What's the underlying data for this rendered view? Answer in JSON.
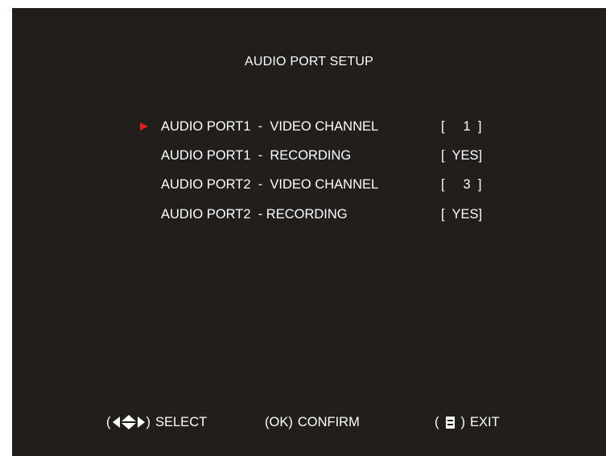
{
  "screen": {
    "title": "AUDIO PORT SETUP"
  },
  "menu": {
    "selected_index": 0,
    "items": [
      {
        "label": "AUDIO PORT1  -  VIDEO CHANNEL",
        "value": "[     1  ]"
      },
      {
        "label": "AUDIO PORT1  -  RECORDING",
        "value": "[  YES]"
      },
      {
        "label": "AUDIO PORT2  -  VIDEO CHANNEL",
        "value": "[     3  ]"
      },
      {
        "label": "AUDIO PORT2  - RECORDING",
        "value": "[  YES]"
      }
    ]
  },
  "footer": {
    "select": {
      "open": "(",
      "close": ")",
      "text": "SELECT",
      "icons": [
        "left-arrow-icon",
        "up-down-arrow-icon",
        "right-arrow-icon"
      ]
    },
    "confirm": {
      "open": "(",
      "key": "OK",
      "close": ")",
      "text": "CONFIRM"
    },
    "exit": {
      "open": "(",
      "close": ")",
      "text": "EXIT",
      "icons": [
        "menu-list-icon"
      ]
    }
  },
  "colors": {
    "background": "#211e1c",
    "text": "#ffffff",
    "pointer": "#e02020"
  }
}
